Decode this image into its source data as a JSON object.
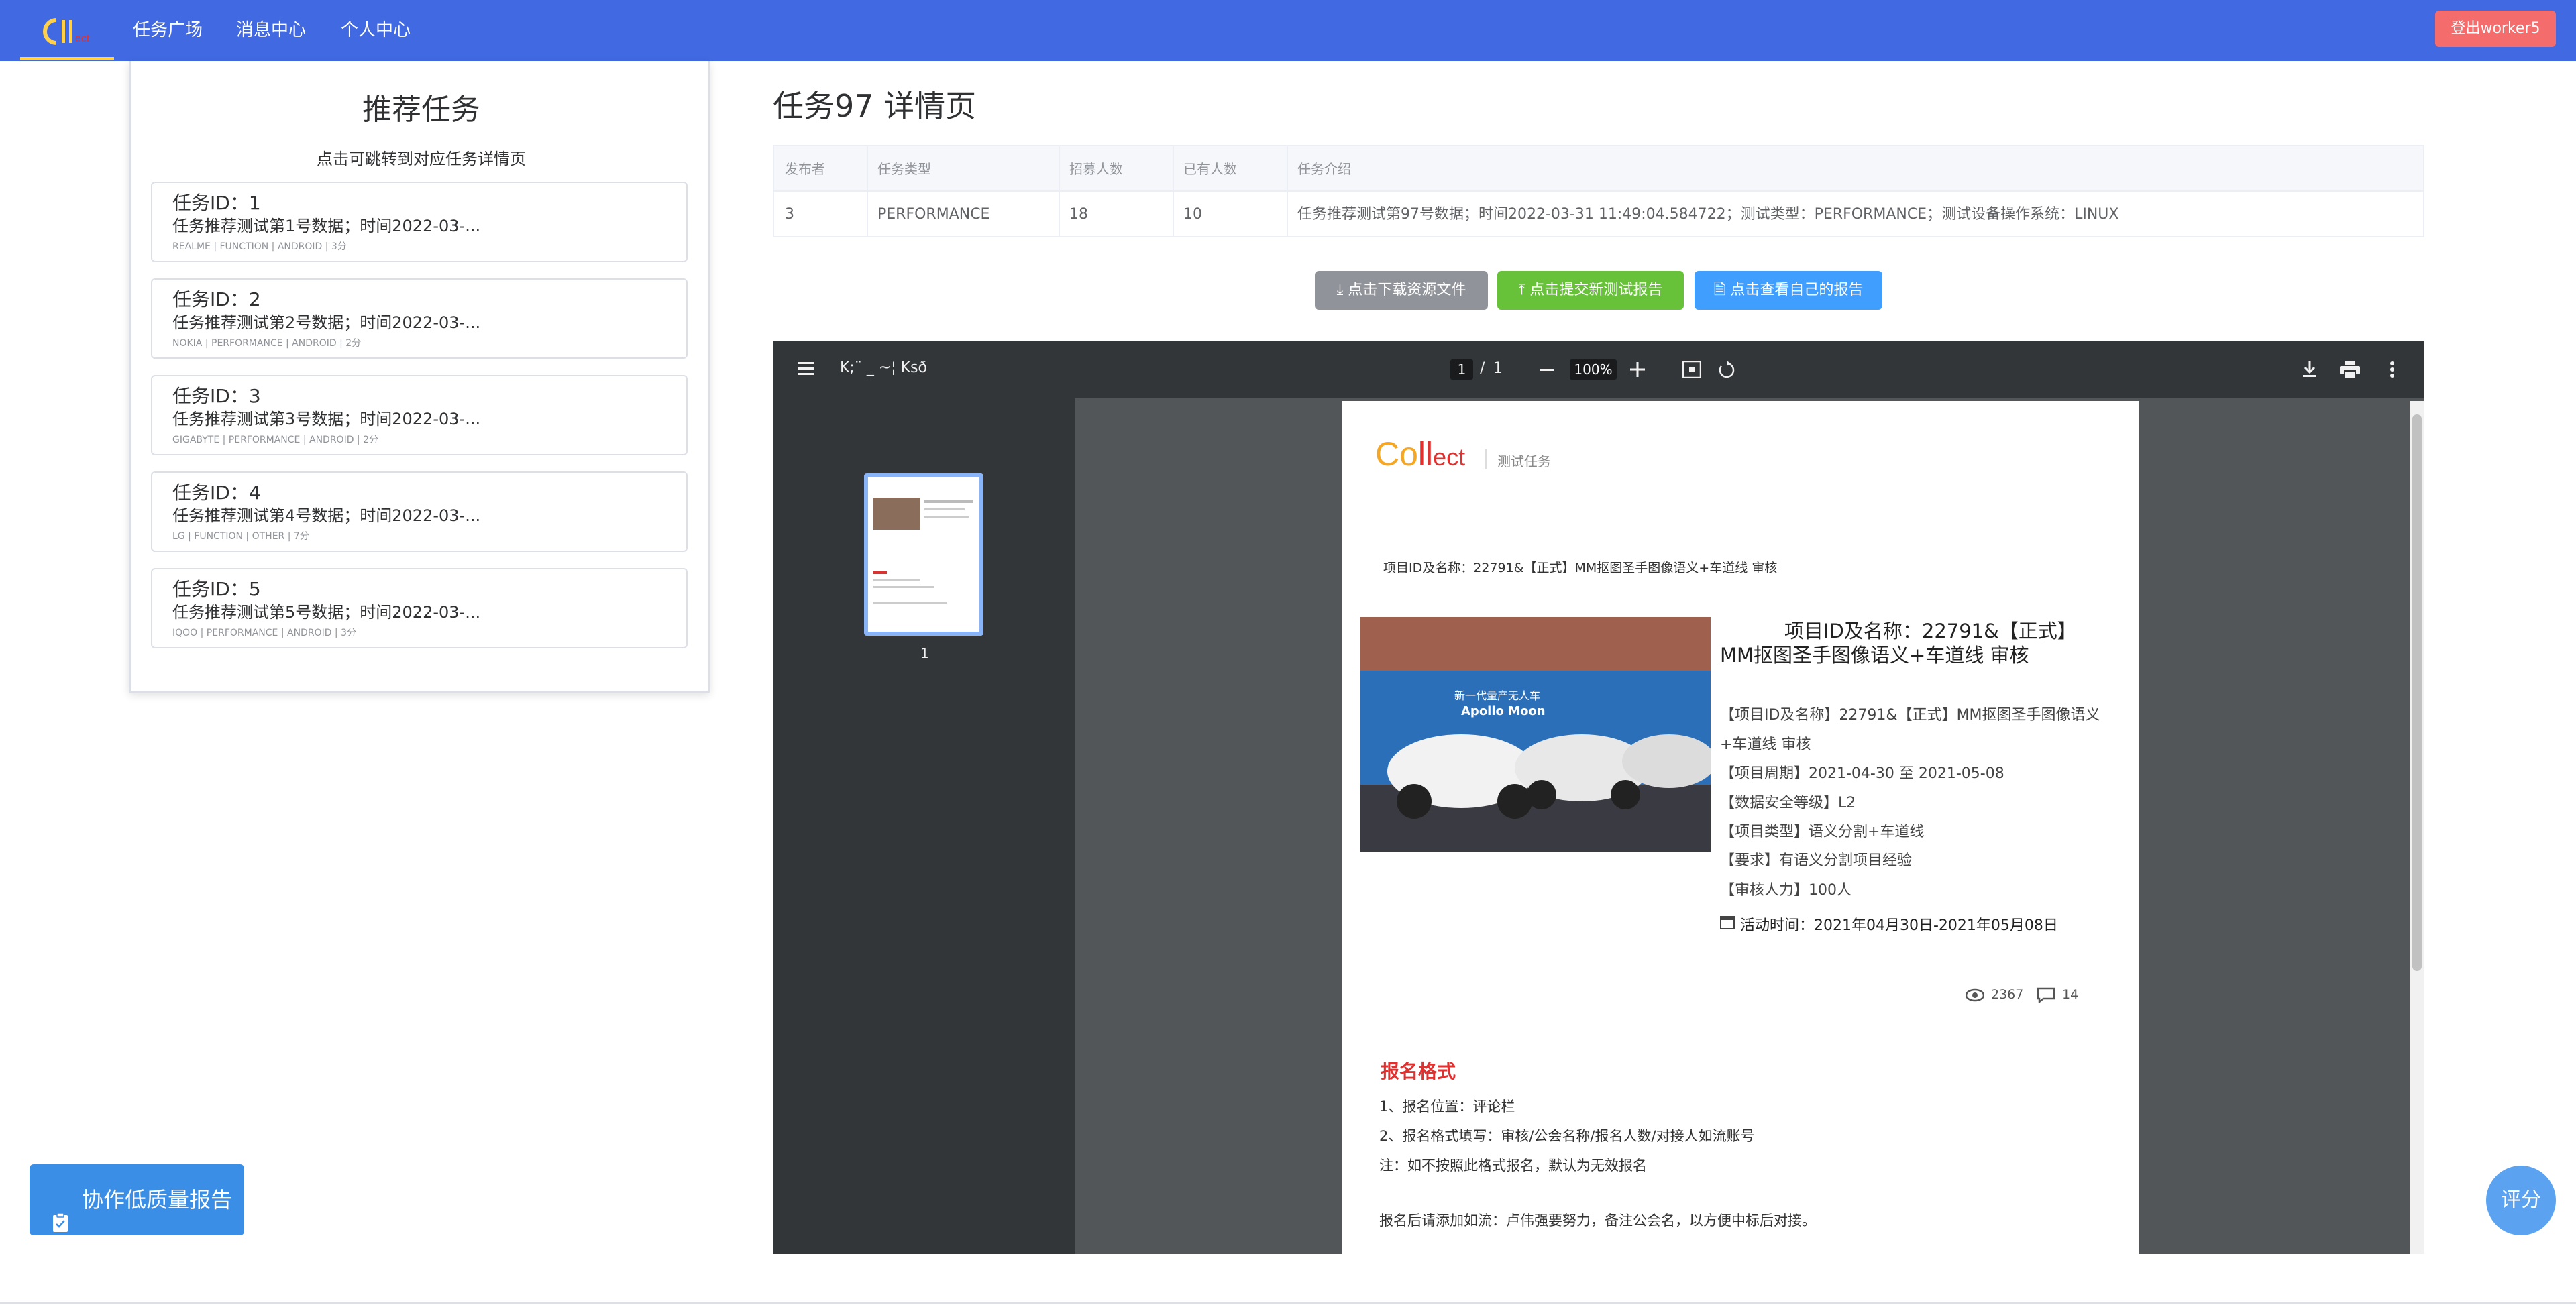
{
  "nav": {
    "items": [
      "任务广场",
      "消息中心",
      "个人中心"
    ],
    "logout_label": "登出worker5"
  },
  "recommend": {
    "title": "推荐任务",
    "subtitle": "点击可跳转到对应任务详情页",
    "cards": [
      {
        "id": "任务ID：1",
        "desc": "任务推荐测试第1号数据；时间2022-03-...",
        "meta": "REALME | FUNCTION | ANDROID | 3分"
      },
      {
        "id": "任务ID：2",
        "desc": "任务推荐测试第2号数据；时间2022-03-...",
        "meta": "NOKIA | PERFORMANCE | ANDROID | 2分"
      },
      {
        "id": "任务ID：3",
        "desc": "任务推荐测试第3号数据；时间2022-03-...",
        "meta": "GIGABYTE | PERFORMANCE | ANDROID | 2分"
      },
      {
        "id": "任务ID：4",
        "desc": "任务推荐测试第4号数据；时间2022-03-...",
        "meta": "LG | FUNCTION | OTHER | 7分"
      },
      {
        "id": "任务ID：5",
        "desc": "任务推荐测试第5号数据；时间2022-03-...",
        "meta": "IQOO | PERFORMANCE | ANDROID | 3分"
      }
    ]
  },
  "collab_button": "协作低质量报告",
  "detail": {
    "title": "任务97 详情页",
    "table": {
      "headers": [
        "发布者",
        "任务类型",
        "招募人数",
        "已有人数",
        "任务介绍"
      ],
      "row": [
        "3",
        "PERFORMANCE",
        "18",
        "10",
        "任务推荐测试第97号数据；时间2022-03-31 11:49:04.584722；测试类型：PERFORMANCE；测试设备操作系统：LINUX"
      ]
    },
    "buttons": {
      "download": "点击下载资源文件",
      "submit": "点击提交新测试报告",
      "view": "点击查看自己的报告"
    },
    "colors": {
      "download": "#909399",
      "submit": "#67c23a",
      "view": "#409eff"
    }
  },
  "pdf": {
    "filename": "K;¨ _ ~¦ Ksð",
    "page_current": "1",
    "page_sep": "/",
    "page_total": "1",
    "zoom": "100%",
    "thumb_label": "1",
    "page": {
      "logo_a": "Co",
      "logo_b": "ll",
      "logo_c": "ect",
      "logo_tag": "测试任务",
      "header_line": "项目ID及名称：22791&【正式】MM抠图圣手图像语义+车道线 审核",
      "title_line1": "项目ID及名称：22791&【正式】",
      "title_line2": "MM抠图圣手图像语义+车道线 审核",
      "photo_caption1": "新一代量产无人车",
      "photo_caption2": "Apollo Moon",
      "info": [
        "【项目ID及名称】22791&【正式】MM抠图圣手图像语义",
        "+车道线 审核",
        "【项目周期】2021-04-30 至 2021-05-08",
        "【数据安全等级】L2",
        "【项目类型】语义分割+车道线",
        "【要求】有语义分割项目经验",
        "【审核人力】100人"
      ],
      "activity": "活动时间：2021年04月30日-2021年05月08日",
      "views": "2367",
      "comments": "14",
      "section_title": "报名格式",
      "rules": [
        "1、报名位置：评论栏",
        "2、报名格式填写：审核/公会名称/报名人数/对接人如流账号",
        "注：如不按照此格式报名，默认为无效报名"
      ],
      "footer": "报名后请添加如流：卢伟强要努力，备注公会名，以方便中标后对接。"
    }
  },
  "rate_button": "评分"
}
